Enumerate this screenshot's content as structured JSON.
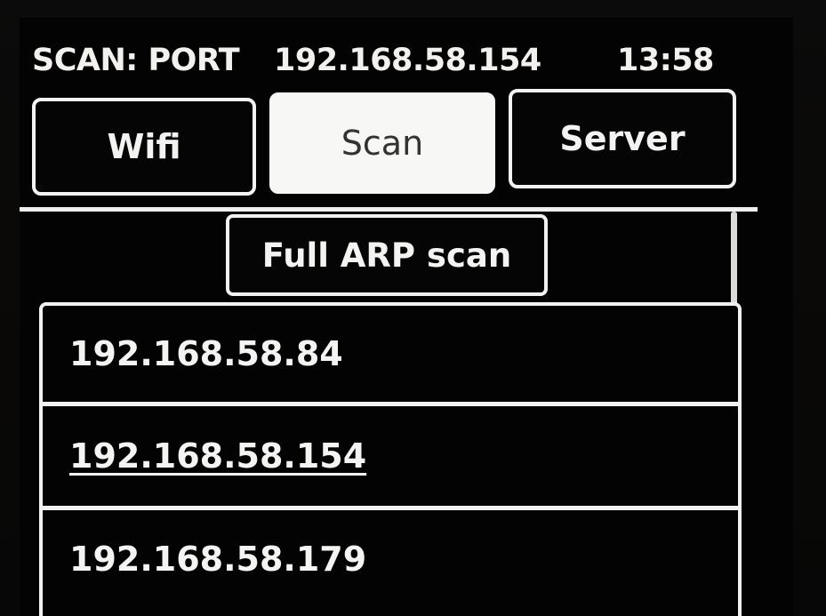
{
  "status_bar": {
    "title": "SCAN: PORT",
    "ip_address": "192.168.58.154",
    "time": "13:58"
  },
  "tabs": [
    {
      "label": "Wifi",
      "active": false
    },
    {
      "label": "Scan",
      "active": true
    },
    {
      "label": "Server",
      "active": false
    }
  ],
  "scan_panel": {
    "full_arp_button_label": "Full ARP scan",
    "hosts": [
      {
        "ip": "192.168.58.84",
        "selected": false
      },
      {
        "ip": "192.168.58.154",
        "selected": true
      },
      {
        "ip": "192.168.58.179",
        "selected": false
      }
    ]
  },
  "colors": {
    "background": "#030303",
    "foreground": "#f3f3f1",
    "active_tab_background": "#f7f7f5",
    "active_tab_text": "#333333"
  }
}
